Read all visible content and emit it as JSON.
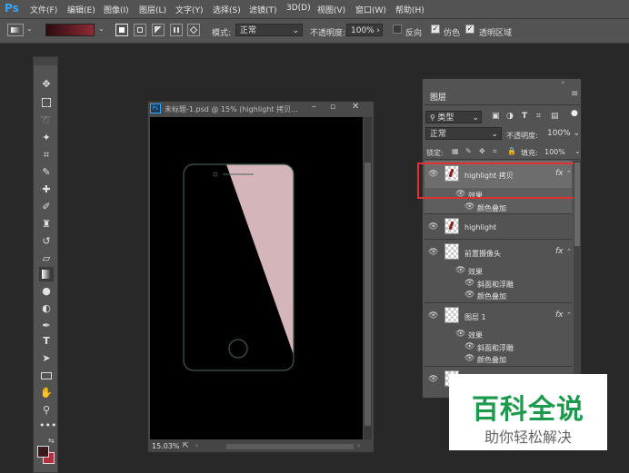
{
  "app": {
    "logo": "Ps"
  },
  "menubar": {
    "items": [
      "文件(F)",
      "编辑(E)",
      "图像(I)",
      "图层(L)",
      "文字(Y)",
      "选择(S)",
      "滤镜(T)",
      "3D(D)",
      "视图(V)",
      "窗口(W)",
      "帮助(H)"
    ]
  },
  "options": {
    "mode_label": "模式:",
    "mode_value": "正常",
    "opacity_label": "不透明度:",
    "opacity_value": "100%",
    "reverse_label": "反向",
    "dither_label": "仿色",
    "transparency_label": "透明区域",
    "reverse_checked": false,
    "dither_checked": true,
    "transparency_checked": true,
    "gradient_colors": [
      "#2a0d10",
      "#8f2a35"
    ]
  },
  "document": {
    "title": "未标题-1.psd @ 15% (highlight 拷贝...",
    "zoom": "15.03%",
    "ps_badge": "Ps"
  },
  "layers_panel": {
    "tab": "图层",
    "filter_kind": "类型",
    "blend_mode": "正常",
    "opacity_label": "不透明度:",
    "opacity_value": "100%",
    "lock_label": "锁定:",
    "fill_label": "填充:",
    "fill_value": "100%",
    "layers": [
      {
        "name": "highlight 拷贝",
        "fx": "fx",
        "selected": true,
        "effects_label": "效果",
        "effects": [
          "颜色叠加"
        ]
      },
      {
        "name": "highlight",
        "fx": "",
        "selected": false,
        "effects_label": "",
        "effects": []
      },
      {
        "name": "前置摄像头",
        "fx": "fx",
        "selected": false,
        "effects_label": "效果",
        "effects": [
          "斜面和浮雕",
          "颜色叠加"
        ]
      },
      {
        "name": "图层 1",
        "fx": "fx",
        "selected": false,
        "effects_label": "效果",
        "effects": [
          "斜面和浮雕",
          "颜色叠加"
        ]
      }
    ]
  },
  "watermark": {
    "title": "百科全说",
    "subtitle": "助你轻松解决",
    "color": "#1a9a4a"
  },
  "colors": {
    "highlight_pink": "#d4b5ba",
    "selection_red": "#e03030"
  }
}
